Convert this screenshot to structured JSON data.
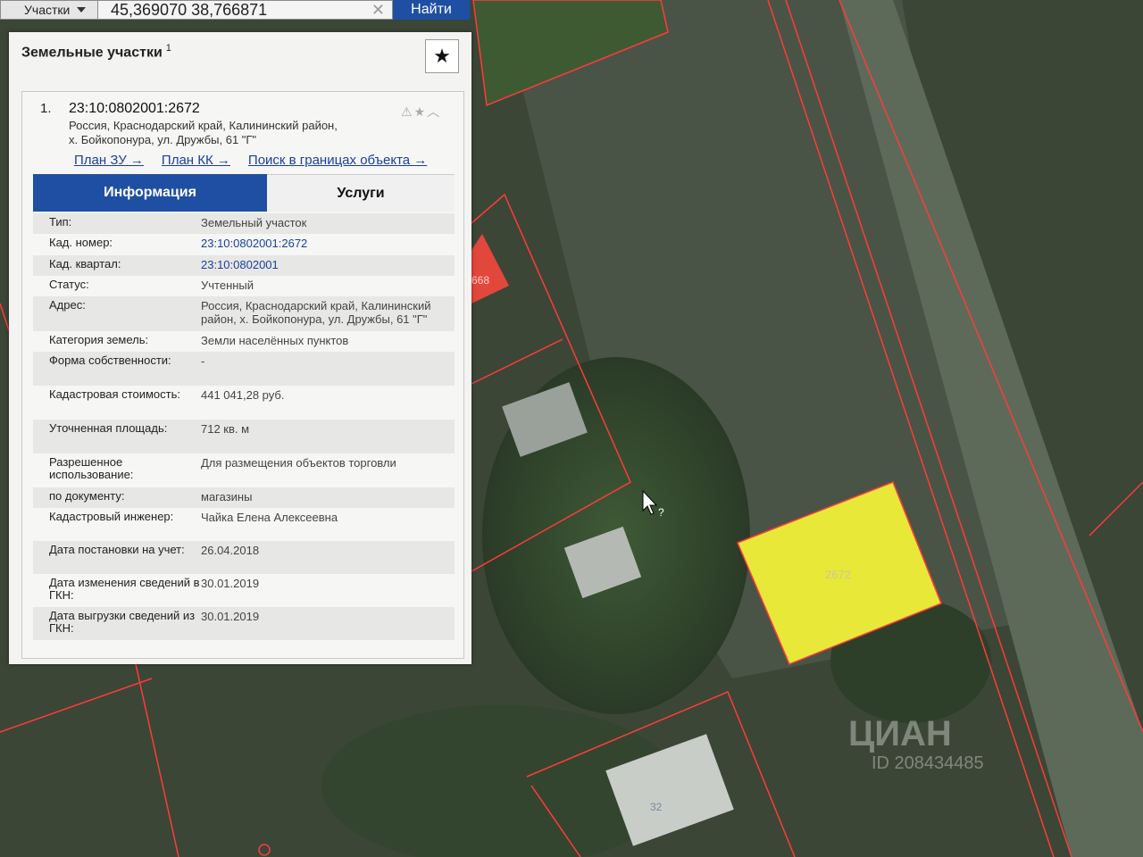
{
  "search": {
    "type_label": "Участки",
    "query": "45,369070 38,766871",
    "find_label": "Найти"
  },
  "panel": {
    "title": "Земельные участки",
    "count": "1"
  },
  "result": {
    "index": "1.",
    "cad_number": "23:10:0802001:2672",
    "address_line1": "Россия, Краснодарский край, Калининский район,",
    "address_line2": "х. Бойкопонура, ул. Дружбы, 61 \"Г\"",
    "links": [
      "План ЗУ →",
      "План КК →",
      "Поиск в границах объекта →"
    ],
    "tabs": [
      "Информация",
      "Услуги"
    ],
    "rows": [
      {
        "label": "Тип:",
        "value": "Земельный участок"
      },
      {
        "label": "Кад. номер:",
        "value": "23:10:0802001:2672"
      },
      {
        "label": "Кад. квартал:",
        "value": "23:10:0802001"
      },
      {
        "label": "Статус:",
        "value": "Учтенный"
      },
      {
        "label": "Адрес:",
        "value": "Россия, Краснодарский край, Калининский район, х. Бойкопонура, ул. Дружбы, 61 \"Г\""
      },
      {
        "label": "Категория земель:",
        "value": "Земли населённых пунктов"
      },
      {
        "label": "Форма собственности:",
        "value": "-"
      },
      {
        "label": "Кадастровая стоимость:",
        "value": "441 041,28 руб."
      },
      {
        "label": "Уточненная площадь:",
        "value": "712 кв. м"
      },
      {
        "label": "Разрешенное использование:",
        "value": "Для размещения объектов торговли"
      },
      {
        "label": "по документу:",
        "value": "магазины"
      },
      {
        "label": "Кадастровый инженер:",
        "value": "Чайка Елена Алексеевна"
      },
      {
        "label": "Дата постановки на учет:",
        "value": "26.04.2018"
      },
      {
        "label": "Дата изменения сведений в ГКН:",
        "value": "30.01.2019"
      },
      {
        "label": "Дата выгрузки сведений из ГКН:",
        "value": "30.01.2019"
      }
    ]
  },
  "map": {
    "highlight_label": "2672",
    "parcel_label_a": "668",
    "parcel_label_b": "32",
    "highlight_color": "#e8e838",
    "boundary_color": "#ff3b3b"
  },
  "watermark": {
    "brand": "ЦИАН",
    "id": "ID 208434485"
  }
}
